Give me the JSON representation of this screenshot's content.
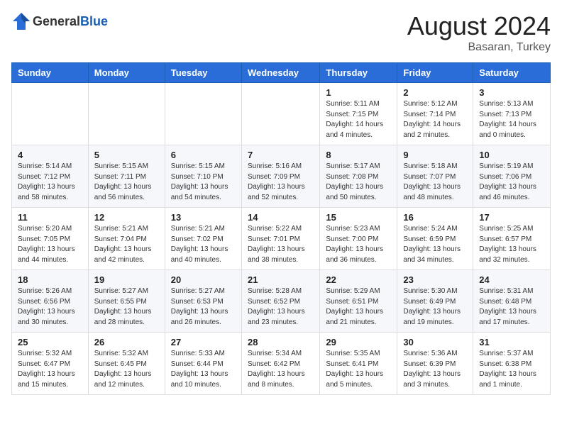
{
  "header": {
    "logo_general": "General",
    "logo_blue": "Blue",
    "month_year": "August 2024",
    "location": "Basaran, Turkey"
  },
  "weekdays": [
    "Sunday",
    "Monday",
    "Tuesday",
    "Wednesday",
    "Thursday",
    "Friday",
    "Saturday"
  ],
  "weeks": [
    [
      {
        "day": "",
        "info": ""
      },
      {
        "day": "",
        "info": ""
      },
      {
        "day": "",
        "info": ""
      },
      {
        "day": "",
        "info": ""
      },
      {
        "day": "1",
        "info": "Sunrise: 5:11 AM\nSunset: 7:15 PM\nDaylight: 14 hours\nand 4 minutes."
      },
      {
        "day": "2",
        "info": "Sunrise: 5:12 AM\nSunset: 7:14 PM\nDaylight: 14 hours\nand 2 minutes."
      },
      {
        "day": "3",
        "info": "Sunrise: 5:13 AM\nSunset: 7:13 PM\nDaylight: 14 hours\nand 0 minutes."
      }
    ],
    [
      {
        "day": "4",
        "info": "Sunrise: 5:14 AM\nSunset: 7:12 PM\nDaylight: 13 hours\nand 58 minutes."
      },
      {
        "day": "5",
        "info": "Sunrise: 5:15 AM\nSunset: 7:11 PM\nDaylight: 13 hours\nand 56 minutes."
      },
      {
        "day": "6",
        "info": "Sunrise: 5:15 AM\nSunset: 7:10 PM\nDaylight: 13 hours\nand 54 minutes."
      },
      {
        "day": "7",
        "info": "Sunrise: 5:16 AM\nSunset: 7:09 PM\nDaylight: 13 hours\nand 52 minutes."
      },
      {
        "day": "8",
        "info": "Sunrise: 5:17 AM\nSunset: 7:08 PM\nDaylight: 13 hours\nand 50 minutes."
      },
      {
        "day": "9",
        "info": "Sunrise: 5:18 AM\nSunset: 7:07 PM\nDaylight: 13 hours\nand 48 minutes."
      },
      {
        "day": "10",
        "info": "Sunrise: 5:19 AM\nSunset: 7:06 PM\nDaylight: 13 hours\nand 46 minutes."
      }
    ],
    [
      {
        "day": "11",
        "info": "Sunrise: 5:20 AM\nSunset: 7:05 PM\nDaylight: 13 hours\nand 44 minutes."
      },
      {
        "day": "12",
        "info": "Sunrise: 5:21 AM\nSunset: 7:04 PM\nDaylight: 13 hours\nand 42 minutes."
      },
      {
        "day": "13",
        "info": "Sunrise: 5:21 AM\nSunset: 7:02 PM\nDaylight: 13 hours\nand 40 minutes."
      },
      {
        "day": "14",
        "info": "Sunrise: 5:22 AM\nSunset: 7:01 PM\nDaylight: 13 hours\nand 38 minutes."
      },
      {
        "day": "15",
        "info": "Sunrise: 5:23 AM\nSunset: 7:00 PM\nDaylight: 13 hours\nand 36 minutes."
      },
      {
        "day": "16",
        "info": "Sunrise: 5:24 AM\nSunset: 6:59 PM\nDaylight: 13 hours\nand 34 minutes."
      },
      {
        "day": "17",
        "info": "Sunrise: 5:25 AM\nSunset: 6:57 PM\nDaylight: 13 hours\nand 32 minutes."
      }
    ],
    [
      {
        "day": "18",
        "info": "Sunrise: 5:26 AM\nSunset: 6:56 PM\nDaylight: 13 hours\nand 30 minutes."
      },
      {
        "day": "19",
        "info": "Sunrise: 5:27 AM\nSunset: 6:55 PM\nDaylight: 13 hours\nand 28 minutes."
      },
      {
        "day": "20",
        "info": "Sunrise: 5:27 AM\nSunset: 6:53 PM\nDaylight: 13 hours\nand 26 minutes."
      },
      {
        "day": "21",
        "info": "Sunrise: 5:28 AM\nSunset: 6:52 PM\nDaylight: 13 hours\nand 23 minutes."
      },
      {
        "day": "22",
        "info": "Sunrise: 5:29 AM\nSunset: 6:51 PM\nDaylight: 13 hours\nand 21 minutes."
      },
      {
        "day": "23",
        "info": "Sunrise: 5:30 AM\nSunset: 6:49 PM\nDaylight: 13 hours\nand 19 minutes."
      },
      {
        "day": "24",
        "info": "Sunrise: 5:31 AM\nSunset: 6:48 PM\nDaylight: 13 hours\nand 17 minutes."
      }
    ],
    [
      {
        "day": "25",
        "info": "Sunrise: 5:32 AM\nSunset: 6:47 PM\nDaylight: 13 hours\nand 15 minutes."
      },
      {
        "day": "26",
        "info": "Sunrise: 5:32 AM\nSunset: 6:45 PM\nDaylight: 13 hours\nand 12 minutes."
      },
      {
        "day": "27",
        "info": "Sunrise: 5:33 AM\nSunset: 6:44 PM\nDaylight: 13 hours\nand 10 minutes."
      },
      {
        "day": "28",
        "info": "Sunrise: 5:34 AM\nSunset: 6:42 PM\nDaylight: 13 hours\nand 8 minutes."
      },
      {
        "day": "29",
        "info": "Sunrise: 5:35 AM\nSunset: 6:41 PM\nDaylight: 13 hours\nand 5 minutes."
      },
      {
        "day": "30",
        "info": "Sunrise: 5:36 AM\nSunset: 6:39 PM\nDaylight: 13 hours\nand 3 minutes."
      },
      {
        "day": "31",
        "info": "Sunrise: 5:37 AM\nSunset: 6:38 PM\nDaylight: 13 hours\nand 1 minute."
      }
    ]
  ]
}
